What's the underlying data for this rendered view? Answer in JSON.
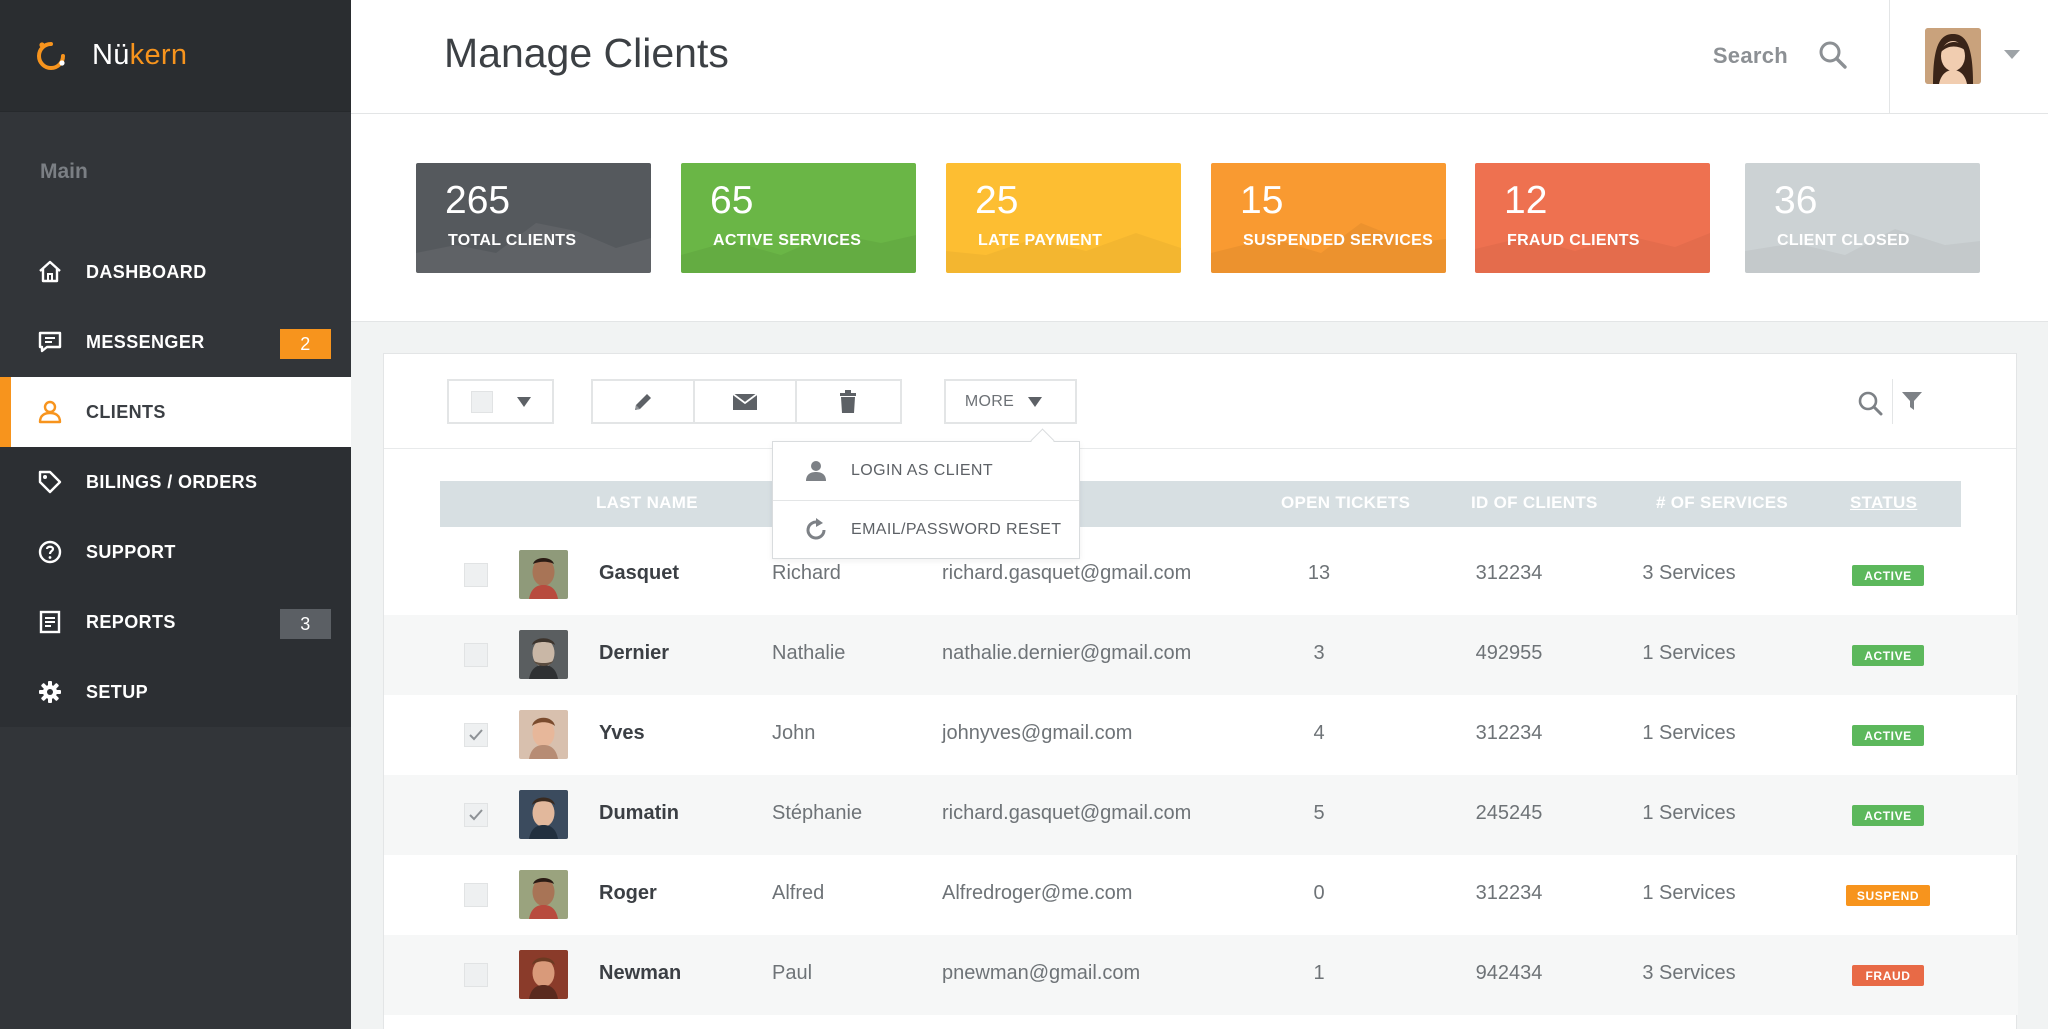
{
  "brand": {
    "name_prefix": "Nü",
    "name_suffix": "kern"
  },
  "sidebar": {
    "section_label": "Main",
    "items": [
      {
        "label": "DASHBOARD",
        "icon": "home-icon"
      },
      {
        "label": "MESSENGER",
        "icon": "chat-icon",
        "badge": "2"
      },
      {
        "label": "CLIENTS",
        "icon": "user-icon",
        "active": true
      },
      {
        "label": "BILINGS / ORDERS",
        "icon": "tag-icon"
      },
      {
        "label": "SUPPORT",
        "icon": "help-icon"
      },
      {
        "label": "REPORTS",
        "icon": "report-icon",
        "badge": "3"
      },
      {
        "label": "SETUP",
        "icon": "gear-icon"
      }
    ]
  },
  "header": {
    "title": "Manage Clients",
    "search_label": "Search"
  },
  "stats": [
    {
      "value": "265",
      "label": "TOTAL CLIENTS",
      "color": "#55595d"
    },
    {
      "value": "65",
      "label": "ACTIVE SERVICES",
      "color": "#6ab646"
    },
    {
      "value": "25",
      "label": "LATE PAYMENT",
      "color": "#fdbe32"
    },
    {
      "value": "15",
      "label": "SUSPENDED SERVICES",
      "color": "#f99a31"
    },
    {
      "value": "12",
      "label": "FRAUD CLIENTS",
      "color": "#ee7150"
    },
    {
      "value": "36",
      "label": "CLIENT CLOSED",
      "color": "#ccd2d4"
    }
  ],
  "toolbar": {
    "more_label": "MORE"
  },
  "dropdown": {
    "items": [
      {
        "label": "LOGIN AS CLIENT",
        "icon": "person-icon"
      },
      {
        "label": "EMAIL/PASSWORD RESET",
        "icon": "refresh-icon"
      }
    ]
  },
  "table": {
    "columns": [
      "LAST NAME",
      "OPEN TICKETS",
      "ID OF CLIENTS",
      "# OF SERVICES",
      "STATUS"
    ],
    "rows": [
      {
        "last": "Gasquet",
        "first": "Richard",
        "email": "richard.gasquet@gmail.com",
        "tickets": "13",
        "id": "312234",
        "services": "3 Services",
        "status": "ACTIVE",
        "checked": false
      },
      {
        "last": "Dernier",
        "first": "Nathalie",
        "email": "nathalie.dernier@gmail.com",
        "tickets": "3",
        "id": "492955",
        "services": "1 Services",
        "status": "ACTIVE",
        "checked": false
      },
      {
        "last": "Yves",
        "first": "John",
        "email": "johnyves@gmail.com",
        "tickets": "4",
        "id": "312234",
        "services": "1 Services",
        "status": "ACTIVE",
        "checked": true
      },
      {
        "last": "Dumatin",
        "first": "Stéphanie",
        "email": "richard.gasquet@gmail.com",
        "tickets": "5",
        "id": "245245",
        "services": "1 Services",
        "status": "ACTIVE",
        "checked": true
      },
      {
        "last": "Roger",
        "first": "Alfred",
        "email": "Alfredroger@me.com",
        "tickets": "0",
        "id": "312234",
        "services": "1 Services",
        "status": "SUSPEND",
        "checked": false
      },
      {
        "last": "Newman",
        "first": "Paul",
        "email": "pnewman@gmail.com",
        "tickets": "1",
        "id": "942434",
        "services": "3 Services",
        "status": "FRAUD",
        "checked": false
      }
    ]
  }
}
